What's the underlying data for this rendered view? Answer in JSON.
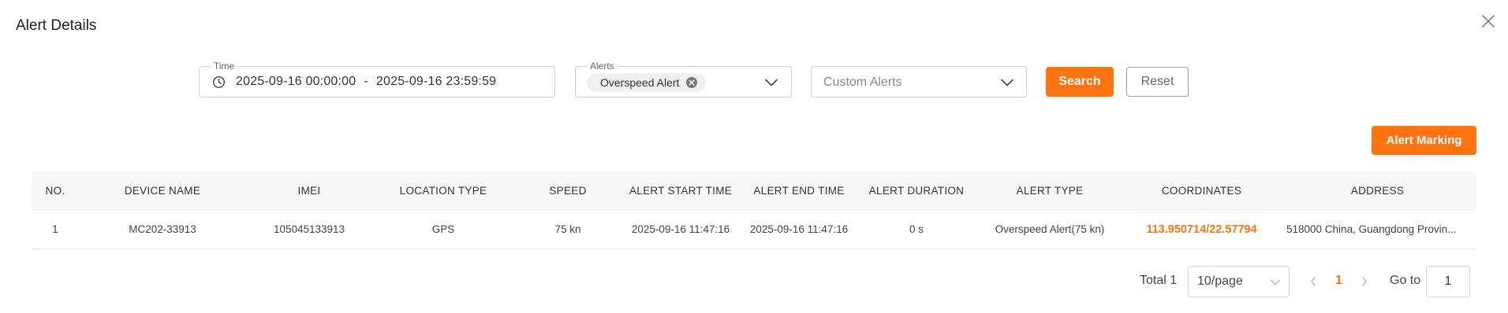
{
  "dialog": {
    "title": "Alert Details"
  },
  "filters": {
    "time": {
      "label": "Time",
      "start": "2025-09-16 00:00:00",
      "separator": "-",
      "end": "2025-09-16 23:59:59"
    },
    "alerts": {
      "label": "Alerts",
      "selected": "Overspeed Alert"
    },
    "custom_alerts": {
      "placeholder": "Custom Alerts"
    },
    "search_label": "Search",
    "reset_label": "Reset"
  },
  "actions": {
    "alert_marking_label": "Alert Marking"
  },
  "table": {
    "headers": [
      "NO.",
      "DEVICE NAME",
      "IMEI",
      "LOCATION TYPE",
      "SPEED",
      "ALERT START TIME",
      "ALERT END TIME",
      "ALERT DURATION",
      "ALERT TYPE",
      "COORDINATES",
      "ADDRESS"
    ],
    "rows": [
      {
        "no": "1",
        "device_name": "MC202-33913",
        "imei": "105045133913",
        "location_type": "GPS",
        "speed": "75 kn",
        "start_time": "2025-09-16 11:47:16",
        "end_time": "2025-09-16 11:47:16",
        "duration": "0 s",
        "alert_type": "Overspeed Alert(75 kn)",
        "coordinates": "113.950714/22.57794",
        "address": "518000 China, Guangdong Provin..."
      }
    ]
  },
  "pagination": {
    "total_label": "Total 1",
    "page_size": "10/page",
    "current_page": "1",
    "goto_label": "Go to",
    "goto_value": "1"
  },
  "colors": {
    "accent": "#ff7411",
    "header_bg": "#f7f8fa"
  }
}
